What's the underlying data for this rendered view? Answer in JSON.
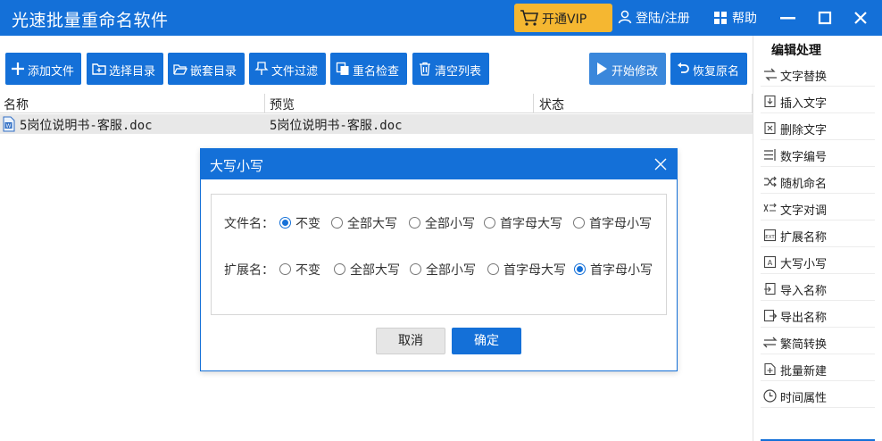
{
  "app": {
    "title": "光速批量重命名软件",
    "vip_label": "开通VIP",
    "login_label": "登陆/注册",
    "help_label": "帮助"
  },
  "toolbar": {
    "add_files": "添加文件",
    "select_dir": "选择目录",
    "nested_dir": "嵌套目录",
    "file_filter": "文件过滤",
    "rename_check": "重名检查",
    "clear_list": "清空列表",
    "start_modify": "开始修改",
    "restore_name": "恢复原名"
  },
  "list": {
    "columns": [
      "名称",
      "预览",
      "状态"
    ],
    "rows": [
      {
        "name": "5岗位说明书-客服.doc",
        "preview": "5岗位说明书-客服.doc",
        "status": ""
      }
    ]
  },
  "right_panel": {
    "title": "编辑处理",
    "items": [
      {
        "label": "文字替换",
        "icon": "replace-icon"
      },
      {
        "label": "插入文字",
        "icon": "insert-icon"
      },
      {
        "label": "删除文字",
        "icon": "delete-text-icon"
      },
      {
        "label": "数字编号",
        "icon": "numbering-icon"
      },
      {
        "label": "随机命名",
        "icon": "shuffle-icon"
      },
      {
        "label": "文字对调",
        "icon": "swap-icon"
      },
      {
        "label": "扩展名称",
        "icon": "extension-icon"
      },
      {
        "label": "大写小写",
        "icon": "case-icon"
      },
      {
        "label": "导入名称",
        "icon": "import-icon"
      },
      {
        "label": "导出名称",
        "icon": "export-icon"
      },
      {
        "label": "繁简转换",
        "icon": "convert-icon"
      },
      {
        "label": "批量新建",
        "icon": "new-file-icon"
      },
      {
        "label": "时间属性",
        "icon": "clock-icon"
      }
    ]
  },
  "dialog": {
    "title": "大写小写",
    "filename_label": "文件名：",
    "extension_label": "扩展名：",
    "options": [
      "不变",
      "全部大写",
      "全部小写",
      "首字母大写",
      "首字母小写"
    ],
    "filename_selected": "不变",
    "extension_selected": "首字母小写",
    "cancel_label": "取消",
    "ok_label": "确定"
  },
  "colors": {
    "primary": "#1470d8",
    "vip": "#f5b731",
    "row_bg": "#e8e8e8"
  }
}
